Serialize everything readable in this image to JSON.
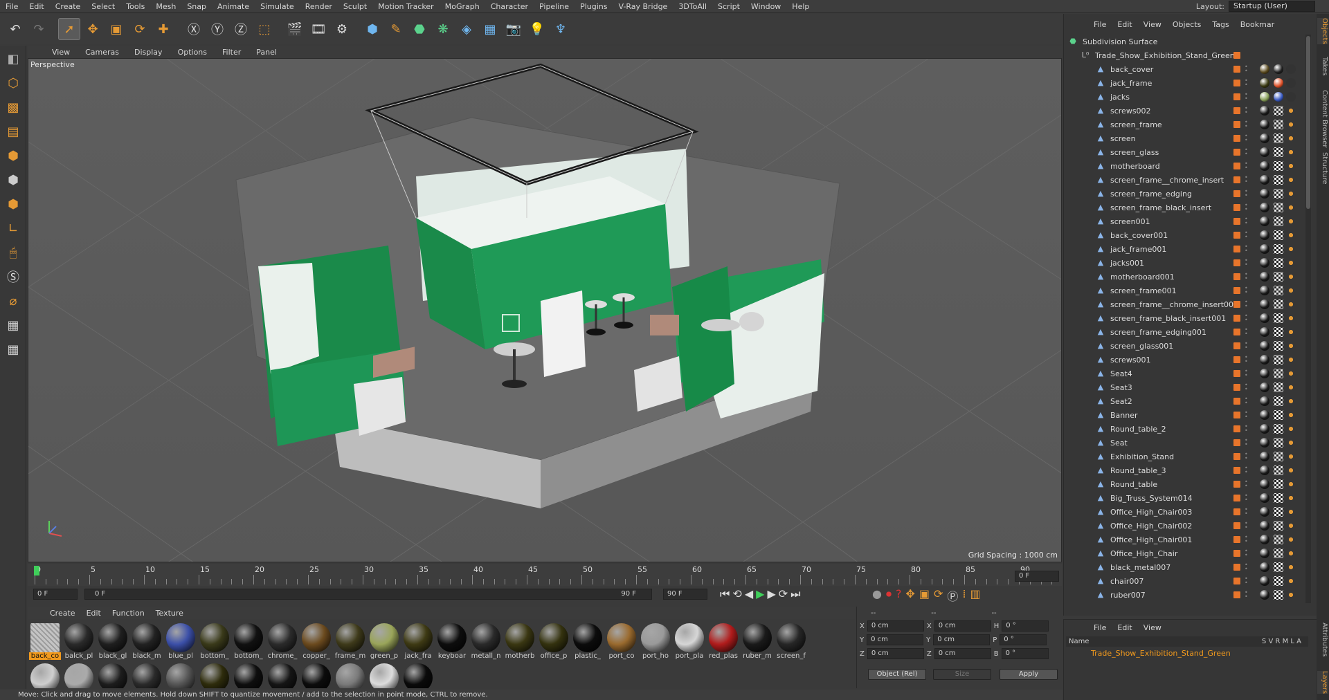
{
  "menubar": {
    "items": [
      "File",
      "Edit",
      "Create",
      "Select",
      "Tools",
      "Mesh",
      "Snap",
      "Animate",
      "Simulate",
      "Render",
      "Sculpt",
      "Motion Tracker",
      "MoGraph",
      "Character",
      "Pipeline",
      "Plugins",
      "V-Ray Bridge",
      "3DToAll",
      "Script",
      "Window",
      "Help"
    ],
    "layout_label": "Layout:",
    "layout_value": "Startup (User)"
  },
  "viewport": {
    "menu": [
      "View",
      "Cameras",
      "Display",
      "Options",
      "Filter",
      "Panel"
    ],
    "label": "Perspective",
    "grid_spacing": "Grid Spacing : 1000 cm"
  },
  "timeline": {
    "ticks": [
      "0",
      "5",
      "10",
      "15",
      "20",
      "25",
      "30",
      "35",
      "40",
      "45",
      "50",
      "55",
      "60",
      "65",
      "70",
      "75",
      "80",
      "85",
      "90"
    ],
    "current_frame": "0 F",
    "start_field": "0 F",
    "range_start": "0 F",
    "range_end": "90 F",
    "end_field": "90 F"
  },
  "materials": {
    "menu": [
      "Create",
      "Edit",
      "Function",
      "Texture"
    ],
    "items": [
      {
        "label": "back_co",
        "color": "#bdbdbd"
      },
      {
        "label": "balck_pl",
        "color": "#2a2a2a"
      },
      {
        "label": "black_gl",
        "color": "#1f1f1f"
      },
      {
        "label": "black_m",
        "color": "#222222"
      },
      {
        "label": "blue_pl",
        "color": "#3b4fa8"
      },
      {
        "label": "bottom_",
        "color": "#3a3a1a"
      },
      {
        "label": "bottom_",
        "color": "#111111"
      },
      {
        "label": "chrome_",
        "color": "#2b2b2b"
      },
      {
        "label": "copper_",
        "color": "#6b4a1e"
      },
      {
        "label": "frame_m",
        "color": "#3e3a1a"
      },
      {
        "label": "green_p",
        "color": "#9aa55a"
      },
      {
        "label": "jack_fra",
        "color": "#3e3a14"
      },
      {
        "label": "keyboar",
        "color": "#0d0d0d"
      },
      {
        "label": "metall_n",
        "color": "#2a2a2a"
      },
      {
        "label": "motherb",
        "color": "#3a3712"
      },
      {
        "label": "office_p",
        "color": "#34320f"
      },
      {
        "label": "plastic_",
        "color": "#0c0c0c"
      },
      {
        "label": "port_co",
        "color": "#9a6a2e"
      },
      {
        "label": "port_ho",
        "color": "#9a9a9a"
      },
      {
        "label": "port_pla",
        "color": "#d6d6d6"
      },
      {
        "label": "red_plas",
        "color": "#b11c1c"
      },
      {
        "label": "ruber_m",
        "color": "#1a1a1a"
      },
      {
        "label": "screen_f",
        "color": "#262626"
      }
    ],
    "row2_colors": [
      "#cfcfcf",
      "#aaaaaa",
      "#1d1d1d",
      "#2a2a2a",
      "#555555",
      "#2e2c0c",
      "#0e0e0e",
      "#151515",
      "#0c0c0c",
      "#7a7a7a",
      "#dcdcdc",
      "#0a0a0a"
    ]
  },
  "coords": {
    "header": [
      "--",
      "--",
      "--"
    ],
    "rows": [
      {
        "a": "X",
        "av": "0 cm",
        "b": "X",
        "bv": "0 cm",
        "c": "H",
        "cv": "0 °"
      },
      {
        "a": "Y",
        "av": "0 cm",
        "b": "Y",
        "bv": "0 cm",
        "c": "P",
        "cv": "0 °"
      },
      {
        "a": "Z",
        "av": "0 cm",
        "b": "Z",
        "bv": "0 cm",
        "c": "B",
        "cv": "0 °"
      }
    ],
    "mode": "Object (Rel)",
    "size": "Size",
    "apply": "Apply"
  },
  "status": "Move: Click and drag to move elements. Hold down SHIFT to quantize movement / add to the selection in point mode, CTRL to remove.",
  "object_manager": {
    "menu": [
      "File",
      "Edit",
      "View",
      "Objects",
      "Tags",
      "Bookmar"
    ],
    "root": "Subdivision Surface",
    "group": "Trade_Show_Exhibition_Stand_Green",
    "objects": [
      "back_cover",
      "jack_frame",
      "jacks",
      "screws002",
      "screen_frame",
      "screen",
      "screen_glass",
      "motherboard",
      "screen_frame__chrome_insert",
      "screen_frame_edging",
      "screen_frame_black_insert",
      "screen001",
      "back_cover001",
      "jack_frame001",
      "jacks001",
      "motherboard001",
      "screen_frame001",
      "screen_frame__chrome_insert001",
      "screen_frame_black_insert001",
      "screen_frame_edging001",
      "screen_glass001",
      "screws001",
      "Seat4",
      "Seat3",
      "Seat2",
      "Banner",
      "Round_table_2",
      "Seat",
      "Exhibition_Stand",
      "Round_table_3",
      "Round_table",
      "Big_Truss_System014",
      "Office_High_Chair003",
      "Office_High_Chair002",
      "Office_High_Chair001",
      "Office_High_Chair",
      "black_metal007",
      "chair007",
      "ruber007"
    ]
  },
  "side_tabs": [
    "Objects",
    "Takes",
    "Content Browser",
    "Structure",
    "Attributes",
    "Layers"
  ],
  "layers": {
    "menu": [
      "File",
      "Edit",
      "View"
    ],
    "header": "Name",
    "cols": "S V R M L A",
    "row": "Trade_Show_Exhibition_Stand_Green"
  }
}
